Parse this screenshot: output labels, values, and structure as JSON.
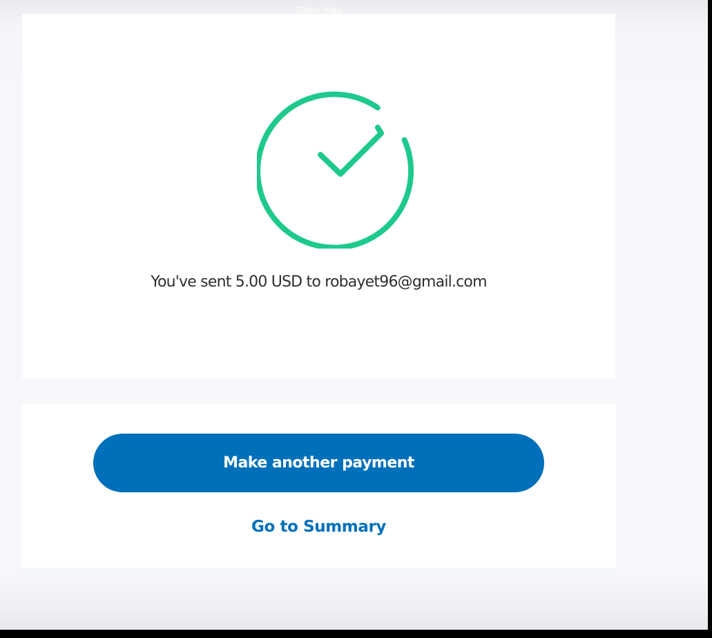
{
  "header": {
    "label": "Safox Algo"
  },
  "result": {
    "icon": "check-circle-icon",
    "icon_color": "#1ec98c",
    "message": "You've sent 5.00 USD to robayet96@gmail.com"
  },
  "actions": {
    "primary_label": "Make another payment",
    "primary_color": "#0070ba",
    "summary_label": "Go to Summary",
    "link_color": "#0070ba"
  }
}
